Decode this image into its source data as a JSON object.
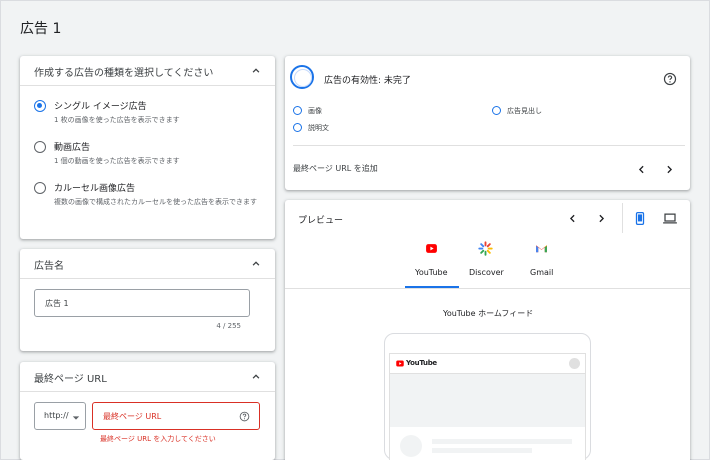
{
  "page": {
    "title": "広告 1"
  },
  "ad_type": {
    "title": "作成する広告の種類を選択してください",
    "options": [
      {
        "label": "シングル イメージ広告",
        "desc": "1 枚の画像を使った広告を表示できます",
        "selected": true
      },
      {
        "label": "動画広告",
        "desc": "1 個の動画を使った広告を表示できます",
        "selected": false
      },
      {
        "label": "カルーセル画像広告",
        "desc": "複数の画像で構成されたカルーセルを使った広告を表示できます",
        "selected": false
      }
    ]
  },
  "ad_name": {
    "title": "広告名",
    "value": "広告 1",
    "counter": "4 / 255"
  },
  "final_url": {
    "title": "最終ページ URL",
    "protocol": "http://",
    "placeholder": "最終ページ URL",
    "error": "最終ページ URL を入力してください"
  },
  "effectiveness": {
    "title": "広告の有効性: 未完了",
    "items": [
      "画像",
      "広告見出し",
      "説明文"
    ],
    "suggestion": "最終ページ URL を追加"
  },
  "preview": {
    "title": "プレビュー",
    "tabs": [
      "YouTube",
      "Discover",
      "Gmail"
    ],
    "active_tab": "YouTube",
    "feed_label": "YouTube ホームフィード",
    "phone_logo": "YouTube"
  },
  "colors": {
    "accent": "#1a73e8",
    "error": "#d93025",
    "youtube_red": "#ff0000"
  }
}
